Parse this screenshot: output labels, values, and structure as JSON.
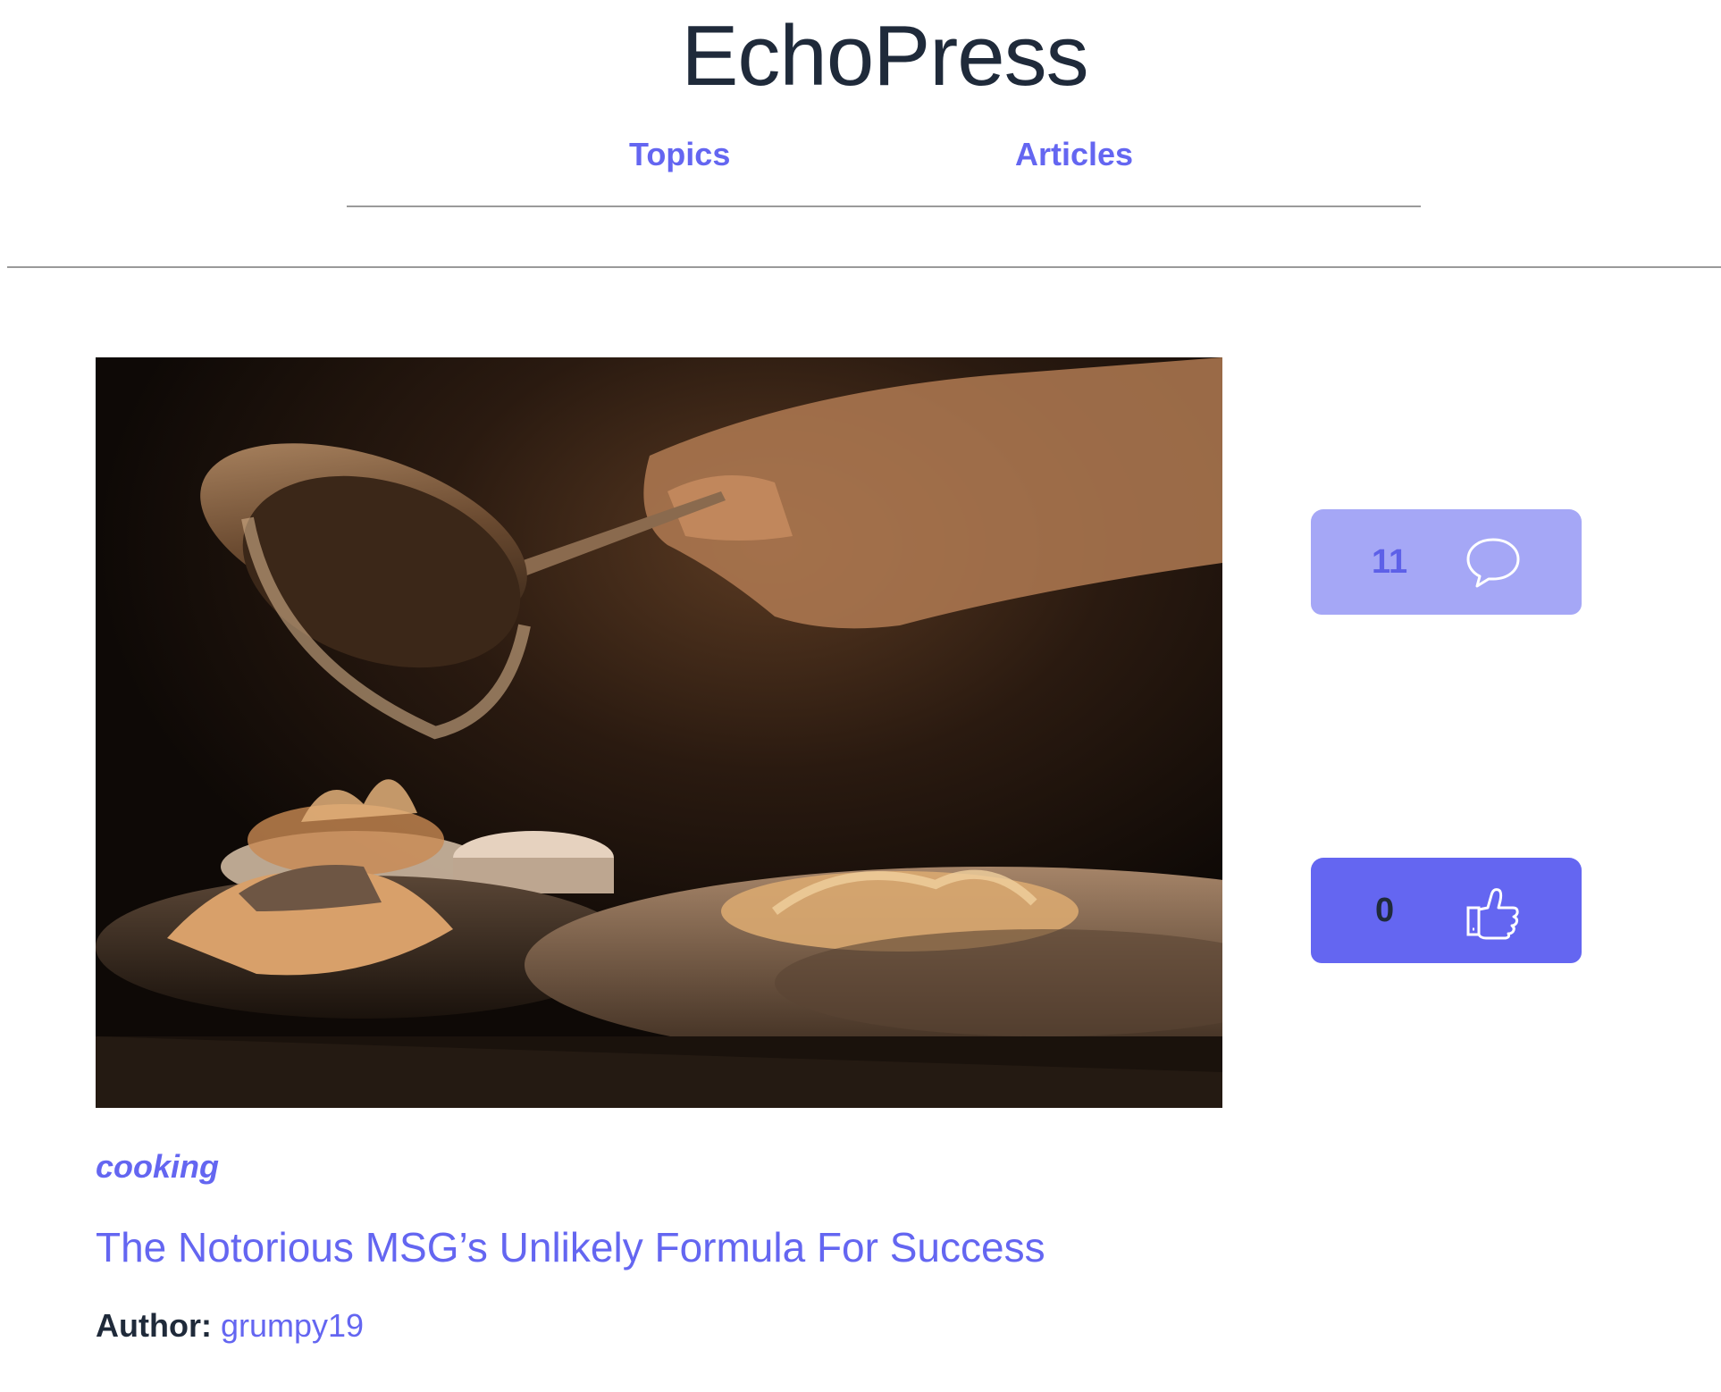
{
  "site": {
    "title": "EchoPress"
  },
  "nav": {
    "items": [
      {
        "label": "Topics"
      },
      {
        "label": "Articles"
      }
    ]
  },
  "article": {
    "image_description_icon": "photo",
    "topic": "cooking",
    "title": "The Notorious MSG’s Unlikely Formula For Success",
    "author_label": "Author:",
    "author": "grumpy19",
    "comment_count": "11",
    "vote_count": "0",
    "comment_icon": "speech-bubble-icon",
    "vote_icon": "thumbs-up-icon"
  },
  "colors": {
    "accent": "#6466f1",
    "accent_light": "#a5a7f6",
    "text": "#1f2a3a",
    "divider": "#9a9a9a"
  }
}
